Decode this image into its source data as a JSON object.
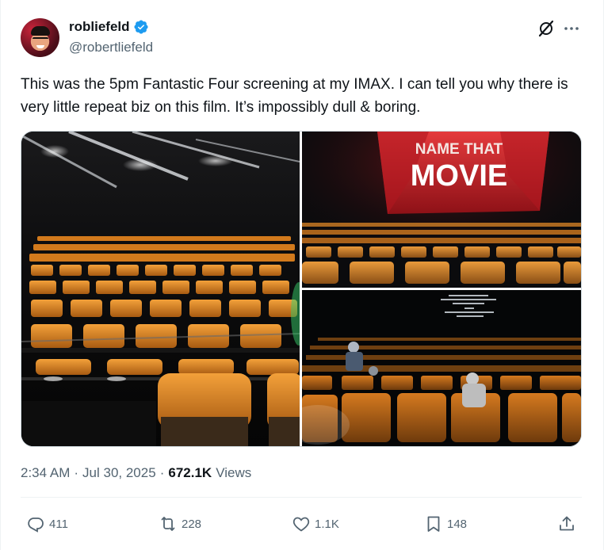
{
  "author": {
    "display_name": "robliefeld",
    "handle": "@robertliefeld",
    "verified": true,
    "avatar": "profile-photo"
  },
  "tweet": {
    "text": "This was the 5pm Fantastic Four screening at my IMAX. I can tell you why there is very little repeat biz on this film. It’s impossibly dull & boring.",
    "time": "2:34 AM",
    "separator": "·",
    "date": "Jul 30, 2025",
    "views_count": "672.1K",
    "views_label": "Views"
  },
  "media": {
    "photos": [
      {
        "subject": "empty-theater-rows"
      },
      {
        "subject": "imax-screen",
        "screen_text_line1": "NAME THAT",
        "screen_text_line2": "MOVIE"
      },
      {
        "subject": "dark-theater-audience"
      }
    ]
  },
  "actions": {
    "replies": "411",
    "reposts": "228",
    "likes": "1.1K",
    "bookmarks": "148"
  },
  "icons": {
    "verified": "verified-badge-icon",
    "grok": "grok-icon",
    "more": "more-dots-icon",
    "reply": "reply-icon",
    "repost": "repost-icon",
    "like": "heart-icon",
    "bookmark": "bookmark-icon",
    "share": "share-icon"
  },
  "colors": {
    "text": "#0f1419",
    "secondary": "#536471",
    "verified": "#1d9bf0",
    "seat_orange": "#e08a1e",
    "screen_red": "#c8202a"
  }
}
